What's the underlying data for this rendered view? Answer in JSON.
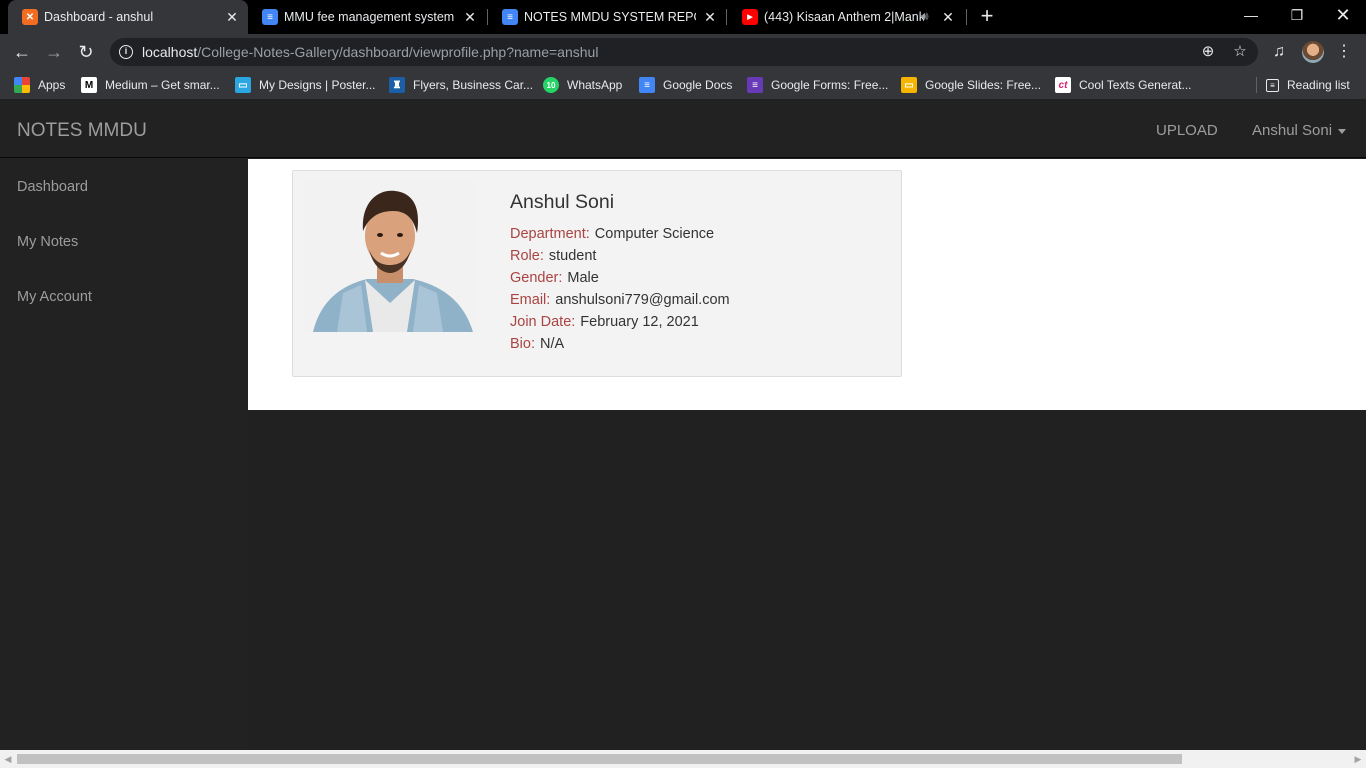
{
  "browser": {
    "tabs": [
      {
        "title": "Dashboard - anshul",
        "favicon": "xampp-icon",
        "fav_color": "#f26d21"
      },
      {
        "title": "MMU fee management system -",
        "favicon": "google-docs-icon",
        "fav_color": "#4285f4"
      },
      {
        "title": "NOTES MMDU SYSTEM REPORT",
        "favicon": "google-docs-icon",
        "fav_color": "#4285f4"
      },
      {
        "title": "(443) Kisaan Anthem 2|Mank",
        "favicon": "youtube-icon",
        "fav_color": "#ff0000"
      }
    ],
    "url_host": "localhost",
    "url_path": "/College-Notes-Gallery/dashboard/viewprofile.php?name=anshul",
    "bookmarks": [
      {
        "label": "Apps",
        "icon": "apps-grid-icon"
      },
      {
        "label": "Medium – Get smar...",
        "icon": "medium-icon"
      },
      {
        "label": "My Designs | Poster...",
        "icon": "postermywall-icon"
      },
      {
        "label": "Flyers, Business Car...",
        "icon": "vistaprint-icon"
      },
      {
        "label": "WhatsApp",
        "icon": "whatsapp-icon",
        "badge": "10"
      },
      {
        "label": "Google Docs",
        "icon": "google-docs-icon"
      },
      {
        "label": "Google Forms: Free...",
        "icon": "google-forms-icon"
      },
      {
        "label": "Google Slides: Free...",
        "icon": "google-slides-icon"
      },
      {
        "label": "Cool Texts Generat...",
        "icon": "cooltext-icon"
      }
    ],
    "reading_list": "Reading list"
  },
  "app": {
    "brand": "NOTES MMDU",
    "nav": {
      "upload": "UPLOAD",
      "user": "Anshul Soni"
    },
    "sidebar": [
      "Dashboard",
      "My Notes",
      "My Account"
    ]
  },
  "profile": {
    "name": "Anshul Soni",
    "fields": [
      {
        "label": "Department:",
        "value": "Computer Science"
      },
      {
        "label": "Role:",
        "value": "student"
      },
      {
        "label": "Gender:",
        "value": "Male"
      },
      {
        "label": "Email:",
        "value": "anshulsoni779@gmail.com"
      },
      {
        "label": "Join Date:",
        "value": "February 12, 2021"
      },
      {
        "label": "Bio:",
        "value": "N/A"
      }
    ]
  },
  "colors": {
    "label_accent": "#a94442",
    "navbar": "#222222",
    "chrome_tab": "#35363a"
  }
}
